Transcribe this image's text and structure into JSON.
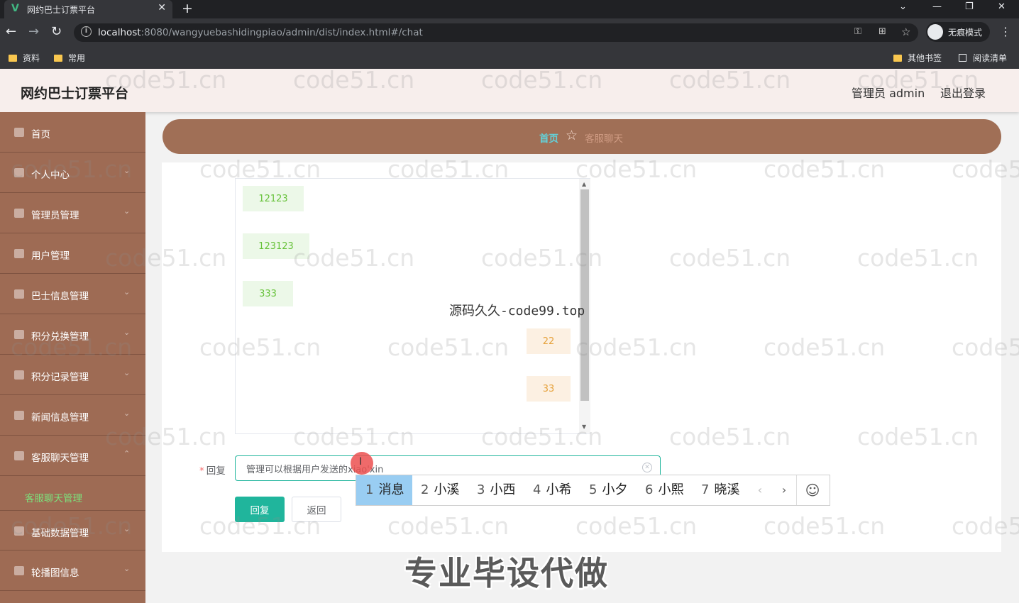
{
  "browser": {
    "tab_title": "网约巴士订票平台",
    "url_host": "localhost",
    "url_rest": ":8080/wangyuebashidingpiao/admin/dist/index.html#/chat",
    "profile_label": "无痕模式",
    "bookmarks": [
      "资料",
      "常用"
    ],
    "bookmarks_right": [
      "其他书签",
      "阅读清单"
    ]
  },
  "header": {
    "brand": "网约巴士订票平台",
    "user_label": "管理员 admin",
    "logout_label": "退出登录",
    "bg_color": "#f7eeec"
  },
  "sidebar": {
    "bg_color": "#9e6b54",
    "items": [
      {
        "label": "首页",
        "icon": "home-icon",
        "expandable": false
      },
      {
        "label": "个人中心",
        "icon": "user-icon",
        "expandable": true
      },
      {
        "label": "管理员管理",
        "icon": "mail-icon",
        "expandable": true
      },
      {
        "label": "用户管理",
        "icon": "file-icon",
        "expandable": false
      },
      {
        "label": "巴士信息管理",
        "icon": "bus-icon",
        "expandable": true
      },
      {
        "label": "积分兑换管理",
        "icon": "mic-icon",
        "expandable": true
      },
      {
        "label": "积分记录管理",
        "icon": "grid-icon",
        "expandable": true
      },
      {
        "label": "新闻信息管理",
        "icon": "news-icon",
        "expandable": true
      },
      {
        "label": "客服聊天管理",
        "icon": "lock-icon",
        "expandable": true
      },
      {
        "label": "基础数据管理",
        "icon": "database-icon",
        "expandable": true
      },
      {
        "label": "轮播图信息",
        "icon": "phone-icon",
        "expandable": true
      }
    ],
    "active_sub_item": "客服聊天管理"
  },
  "breadcrumb": {
    "home": "首页",
    "current": "客服聊天"
  },
  "chat": {
    "messages": [
      {
        "side": "left",
        "text": "12123"
      },
      {
        "side": "left",
        "text": "123123"
      },
      {
        "side": "left",
        "text": "333"
      },
      {
        "side": "right",
        "text": "22"
      },
      {
        "side": "right",
        "text": "33"
      }
    ]
  },
  "form": {
    "reply_label": "回复",
    "reply_value": "管理可以根据用户发送的xiao'xin",
    "reply_button": "回复",
    "back_button": "返回",
    "accent_color": "#20b59c"
  },
  "ime": {
    "candidates": [
      {
        "n": "1",
        "text": "消息"
      },
      {
        "n": "2",
        "text": "小溪"
      },
      {
        "n": "3",
        "text": "小西"
      },
      {
        "n": "4",
        "text": "小希"
      },
      {
        "n": "5",
        "text": "小夕"
      },
      {
        "n": "6",
        "text": "小熙"
      },
      {
        "n": "7",
        "text": "晓溪"
      }
    ],
    "prev": "‹",
    "next": "›",
    "emoji": "☺"
  },
  "watermarks": {
    "repeat": "code51.cn",
    "center": "源码久久-code99.top",
    "bottom": "专业毕设代做"
  }
}
